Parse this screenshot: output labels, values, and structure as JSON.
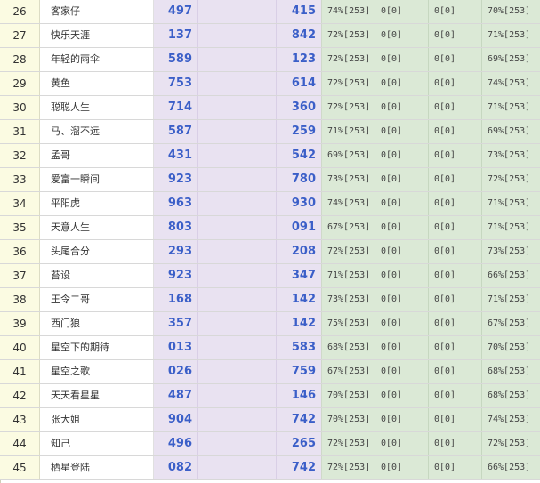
{
  "rows": [
    {
      "rank": "26",
      "name": "客家仔",
      "a": "497",
      "b": "415",
      "g1": "74%[253]",
      "g2": "0[0]",
      "g3": "0[0]",
      "g4": "70%[253]"
    },
    {
      "rank": "27",
      "name": "快乐天涯",
      "a": "137",
      "b": "842",
      "g1": "72%[253]",
      "g2": "0[0]",
      "g3": "0[0]",
      "g4": "71%[253]"
    },
    {
      "rank": "28",
      "name": "年轻的雨伞",
      "a": "589",
      "b": "123",
      "g1": "72%[253]",
      "g2": "0[0]",
      "g3": "0[0]",
      "g4": "69%[253]"
    },
    {
      "rank": "29",
      "name": "黄鱼",
      "a": "753",
      "b": "614",
      "g1": "72%[253]",
      "g2": "0[0]",
      "g3": "0[0]",
      "g4": "74%[253]"
    },
    {
      "rank": "30",
      "name": "聪聪人生",
      "a": "714",
      "b": "360",
      "g1": "72%[253]",
      "g2": "0[0]",
      "g3": "0[0]",
      "g4": "71%[253]"
    },
    {
      "rank": "31",
      "name": "马、溜不远",
      "a": "587",
      "b": "259",
      "g1": "71%[253]",
      "g2": "0[0]",
      "g3": "0[0]",
      "g4": "69%[253]"
    },
    {
      "rank": "32",
      "name": "孟哥",
      "a": "431",
      "b": "542",
      "g1": "69%[253]",
      "g2": "0[0]",
      "g3": "0[0]",
      "g4": "73%[253]"
    },
    {
      "rank": "33",
      "name": "爱富一瞬间",
      "a": "923",
      "b": "780",
      "g1": "73%[253]",
      "g2": "0[0]",
      "g3": "0[0]",
      "g4": "72%[253]"
    },
    {
      "rank": "34",
      "name": "平阳虎",
      "a": "963",
      "b": "930",
      "g1": "74%[253]",
      "g2": "0[0]",
      "g3": "0[0]",
      "g4": "71%[253]"
    },
    {
      "rank": "35",
      "name": "天意人生",
      "a": "803",
      "b": "091",
      "g1": "67%[253]",
      "g2": "0[0]",
      "g3": "0[0]",
      "g4": "71%[253]"
    },
    {
      "rank": "36",
      "name": "头尾合分",
      "a": "293",
      "b": "208",
      "g1": "72%[253]",
      "g2": "0[0]",
      "g3": "0[0]",
      "g4": "73%[253]"
    },
    {
      "rank": "37",
      "name": "苔设",
      "a": "923",
      "b": "347",
      "g1": "71%[253]",
      "g2": "0[0]",
      "g3": "0[0]",
      "g4": "66%[253]"
    },
    {
      "rank": "38",
      "name": "王令二哥",
      "a": "168",
      "b": "142",
      "g1": "73%[253]",
      "g2": "0[0]",
      "g3": "0[0]",
      "g4": "71%[253]"
    },
    {
      "rank": "39",
      "name": "西门狼",
      "a": "357",
      "b": "142",
      "g1": "75%[253]",
      "g2": "0[0]",
      "g3": "0[0]",
      "g4": "67%[253]"
    },
    {
      "rank": "40",
      "name": "星空下的期待",
      "a": "013",
      "b": "583",
      "g1": "68%[253]",
      "g2": "0[0]",
      "g3": "0[0]",
      "g4": "70%[253]"
    },
    {
      "rank": "41",
      "name": "星空之歌",
      "a": "026",
      "b": "759",
      "g1": "67%[253]",
      "g2": "0[0]",
      "g3": "0[0]",
      "g4": "68%[253]"
    },
    {
      "rank": "42",
      "name": "天天看星星",
      "a": "487",
      "b": "146",
      "g1": "70%[253]",
      "g2": "0[0]",
      "g3": "0[0]",
      "g4": "68%[253]"
    },
    {
      "rank": "43",
      "name": "张大姐",
      "a": "904",
      "b": "742",
      "g1": "70%[253]",
      "g2": "0[0]",
      "g3": "0[0]",
      "g4": "74%[253]"
    },
    {
      "rank": "44",
      "name": "知己",
      "a": "496",
      "b": "265",
      "g1": "72%[253]",
      "g2": "0[0]",
      "g3": "0[0]",
      "g4": "72%[253]"
    },
    {
      "rank": "45",
      "name": "栖星登陆",
      "a": "082",
      "b": "742",
      "g1": "72%[253]",
      "g2": "0[0]",
      "g3": "0[0]",
      "g4": "66%[253]"
    }
  ]
}
